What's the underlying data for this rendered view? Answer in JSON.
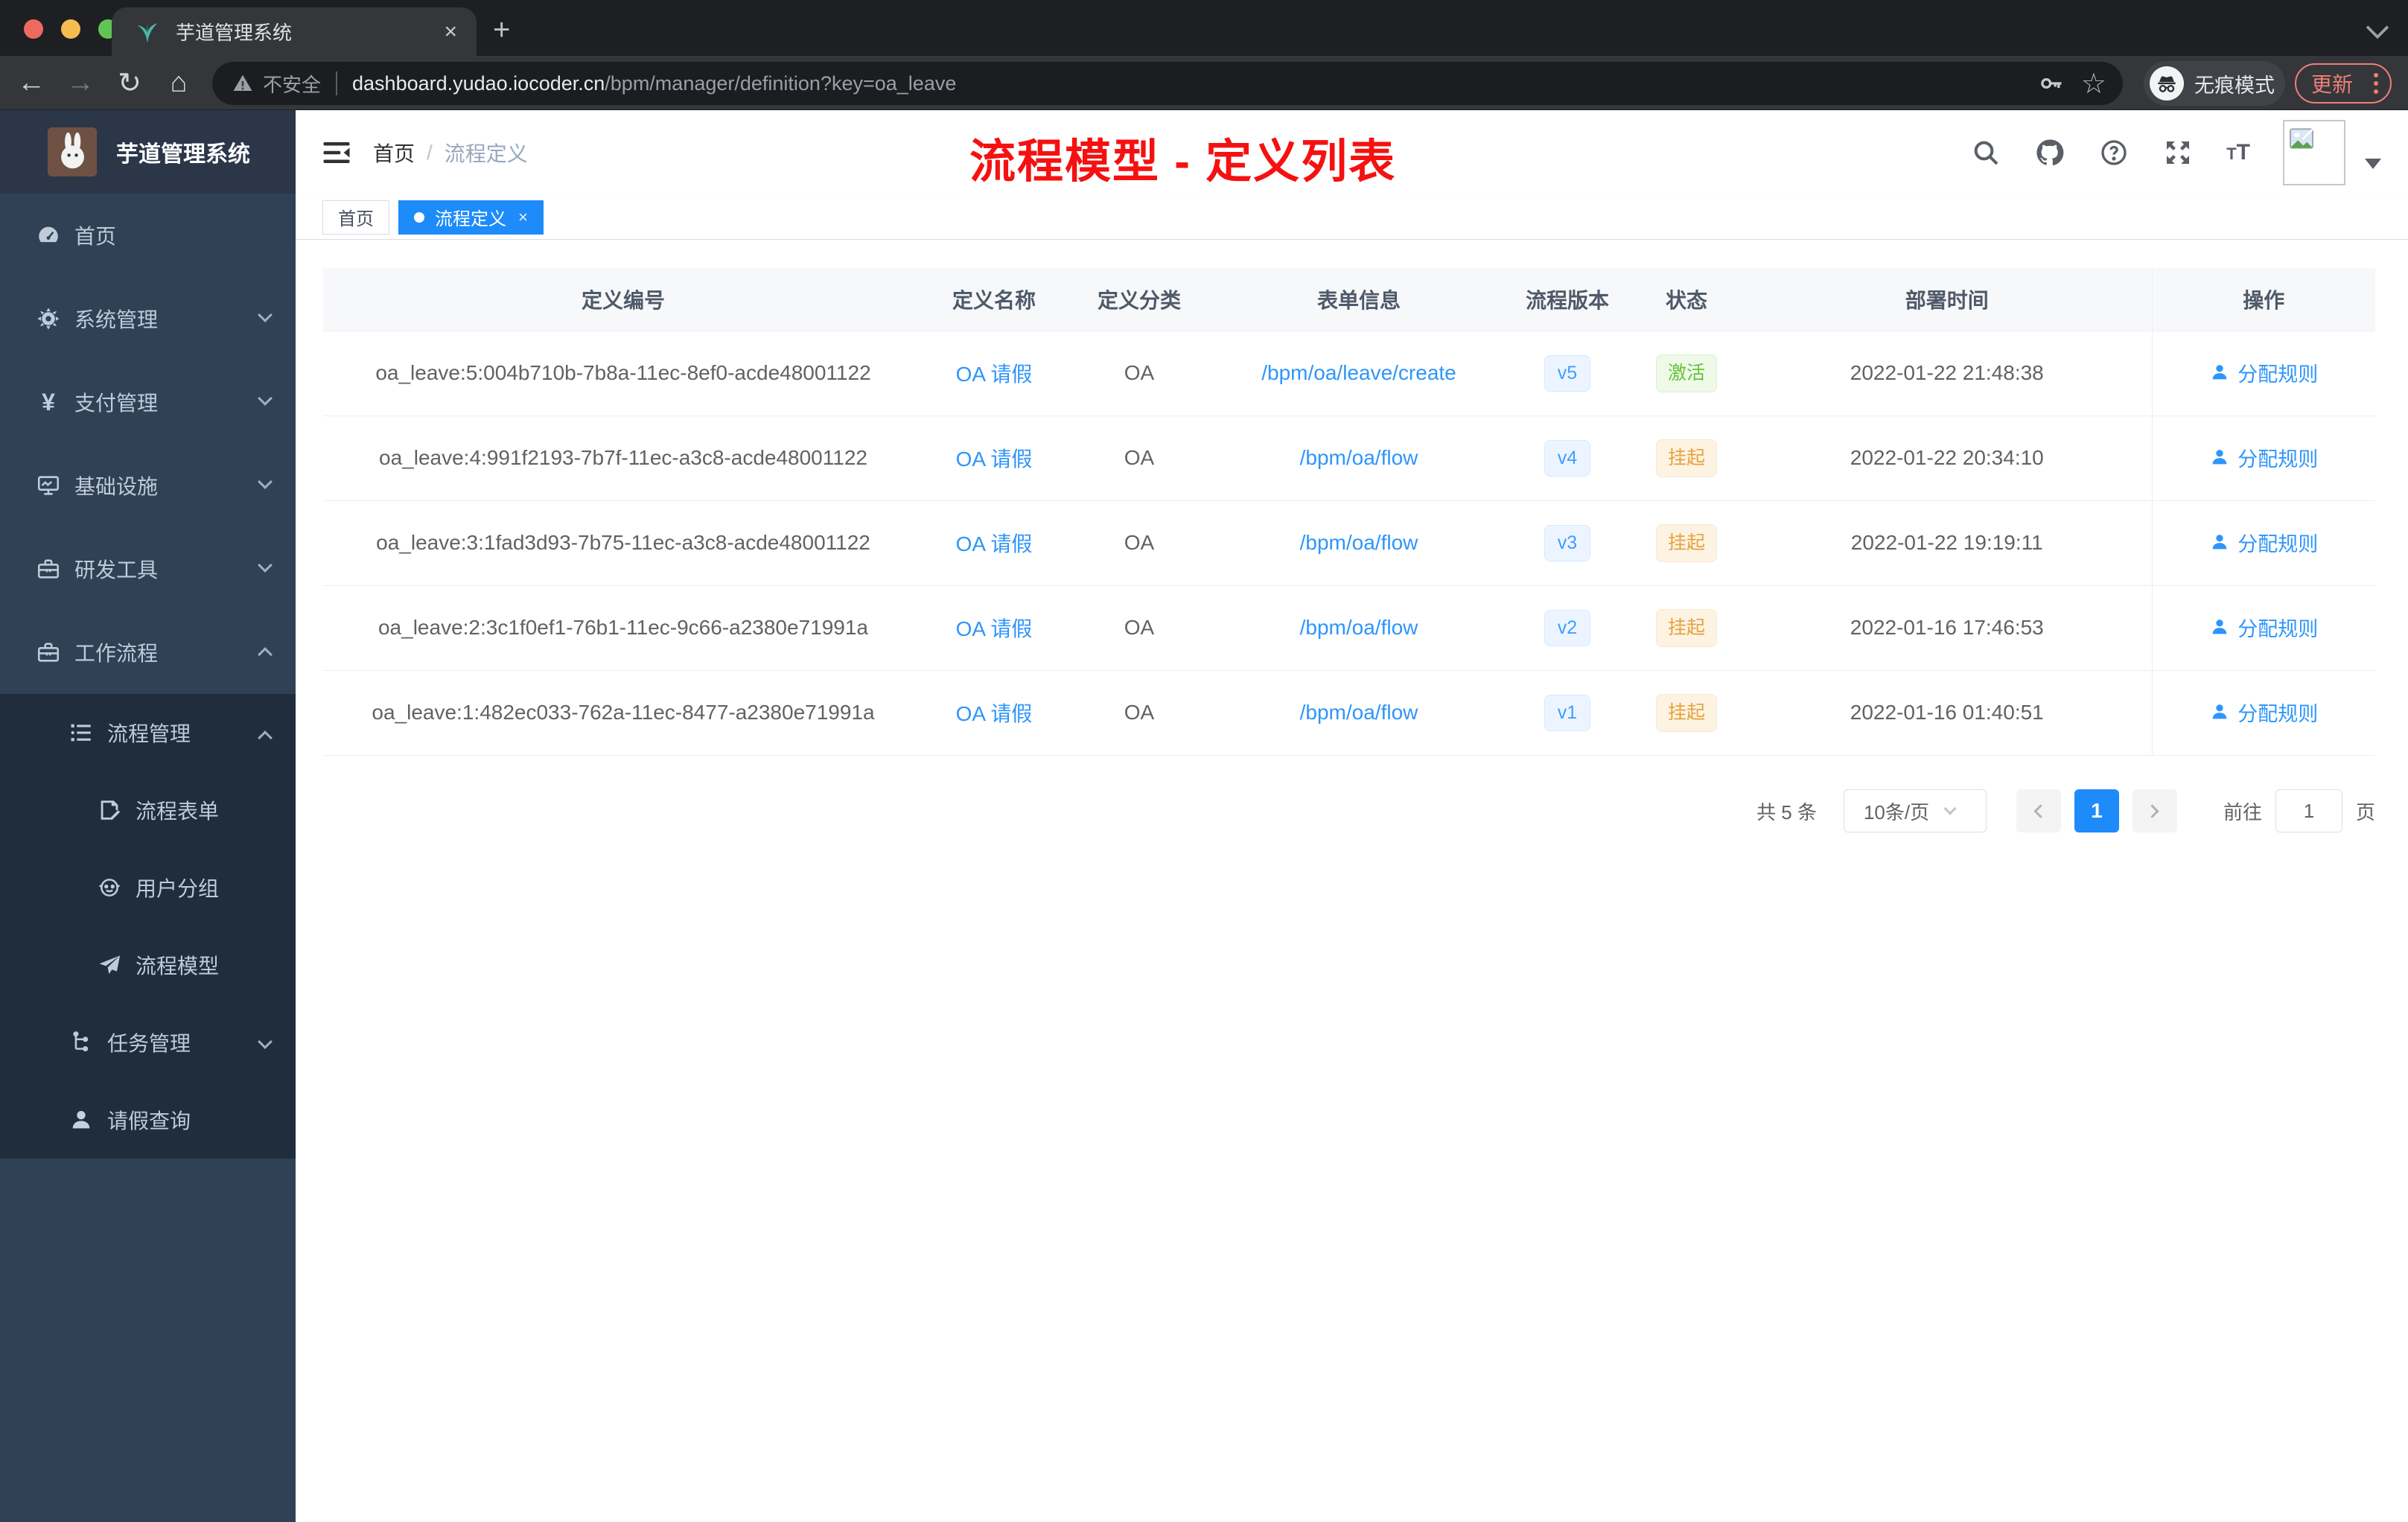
{
  "browser": {
    "tab_title": "芋道管理系统",
    "not_secure": "不安全",
    "url_domain": "dashboard.yudao.iocoder.cn",
    "url_path": "/bpm/manager/definition?key=oa_leave",
    "incognito_label": "无痕模式",
    "update_label": "更新"
  },
  "sidebar": {
    "title": "芋道管理系统",
    "items": [
      {
        "label": "首页",
        "icon": "dashboard-icon"
      },
      {
        "label": "系统管理",
        "icon": "gear-icon"
      },
      {
        "label": "支付管理",
        "icon": "yen-icon"
      },
      {
        "label": "基础设施",
        "icon": "monitor-icon"
      },
      {
        "label": "研发工具",
        "icon": "toolbox-icon"
      },
      {
        "label": "工作流程",
        "icon": "briefcase-icon"
      },
      {
        "label": "流程管理",
        "icon": "list-icon"
      },
      {
        "label": "流程表单",
        "icon": "form-icon"
      },
      {
        "label": "用户分组",
        "icon": "user-group-icon"
      },
      {
        "label": "流程模型",
        "icon": "paper-plane-icon"
      },
      {
        "label": "任务管理",
        "icon": "tree-icon"
      },
      {
        "label": "请假查询",
        "icon": "person-icon"
      }
    ]
  },
  "navbar": {
    "breadcrumb_home": "首页",
    "breadcrumb_current": "流程定义",
    "annotation": "流程模型 - 定义列表"
  },
  "tags": [
    {
      "label": "首页",
      "active": false
    },
    {
      "label": "流程定义",
      "active": true
    }
  ],
  "table": {
    "columns": [
      "定义编号",
      "定义名称",
      "定义分类",
      "表单信息",
      "流程版本",
      "状态",
      "部署时间",
      "操作"
    ],
    "action_label": "分配规则",
    "rows": [
      {
        "id": "oa_leave:5:004b710b-7b8a-11ec-8ef0-acde48001122",
        "name": "OA 请假",
        "category": "OA",
        "form": "/bpm/oa/leave/create",
        "version": "v5",
        "status": "激活",
        "time": "2022-01-22 21:48:38"
      },
      {
        "id": "oa_leave:4:991f2193-7b7f-11ec-a3c8-acde48001122",
        "name": "OA 请假",
        "category": "OA",
        "form": "/bpm/oa/flow",
        "version": "v4",
        "status": "挂起",
        "time": "2022-01-22 20:34:10"
      },
      {
        "id": "oa_leave:3:1fad3d93-7b75-11ec-a3c8-acde48001122",
        "name": "OA 请假",
        "category": "OA",
        "form": "/bpm/oa/flow",
        "version": "v3",
        "status": "挂起",
        "time": "2022-01-22 19:19:11"
      },
      {
        "id": "oa_leave:2:3c1f0ef1-76b1-11ec-9c66-a2380e71991a",
        "name": "OA 请假",
        "category": "OA",
        "form": "/bpm/oa/flow",
        "version": "v2",
        "status": "挂起",
        "time": "2022-01-16 17:46:53"
      },
      {
        "id": "oa_leave:1:482ec033-762a-11ec-8477-a2380e71991a",
        "name": "OA 请假",
        "category": "OA",
        "form": "/bpm/oa/flow",
        "version": "v1",
        "status": "挂起",
        "time": "2022-01-16 01:40:51"
      }
    ]
  },
  "pagination": {
    "total_label": "共 5 条",
    "page_size": "10条/页",
    "current_page": "1",
    "goto_label": "前往",
    "goto_value": "1",
    "page_suffix": "页"
  },
  "colors": {
    "accent_blue": "#1e8bfa",
    "link_blue": "#2e95fb",
    "badge_blue": "#409eff",
    "status_green": "#67c23a",
    "status_yellow": "#e6a23c",
    "sidebar_bg": "#304156",
    "sidebar_sub_bg": "#1f2d3d",
    "annotation_red": "#f51111",
    "update_salmon": "#ed8077"
  }
}
